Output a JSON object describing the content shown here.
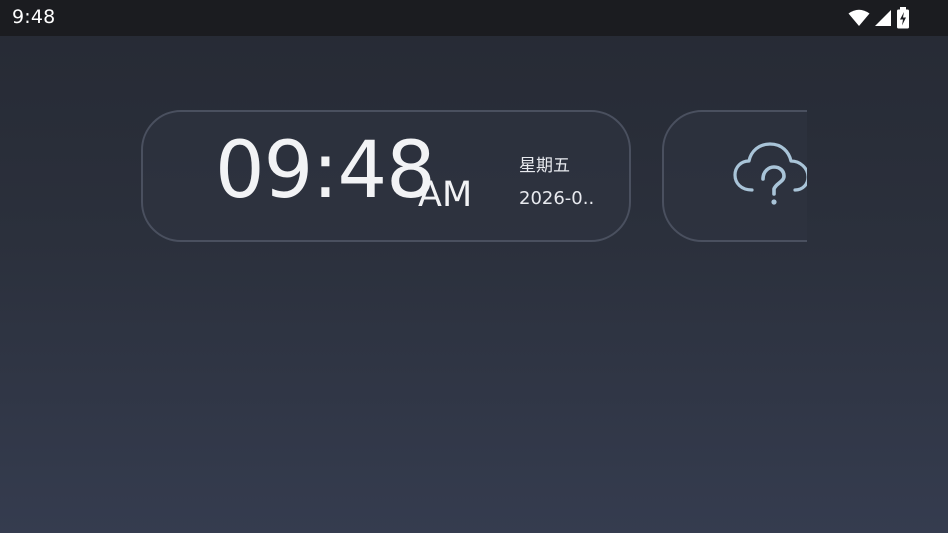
{
  "status_bar": {
    "time": "9:48",
    "icons": [
      "wifi-icon",
      "signal-icon",
      "battery-charging-icon"
    ]
  },
  "clock_card": {
    "time": "09:48",
    "ampm": "AM",
    "weekday": "星期五",
    "date": "2026-0.."
  },
  "weather_card": {
    "icon": "cloud-question-icon"
  }
}
